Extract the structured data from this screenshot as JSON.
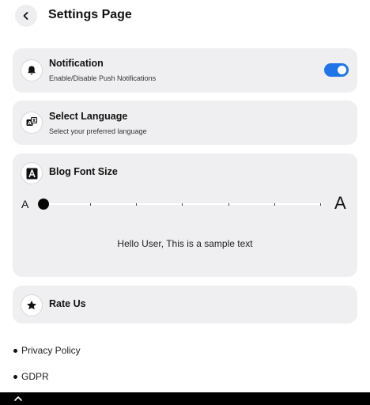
{
  "header": {
    "back_icon": "chevron-left-icon",
    "title": "Settings Page"
  },
  "notification": {
    "icon": "bell-icon",
    "title": "Notification",
    "subtitle": "Enable/Disable Push Notifications",
    "enabled": true,
    "toggle_color": "#1f75e8"
  },
  "language": {
    "icon": "translate-icon",
    "title": "Select Language",
    "subtitle": "Select your preferred language"
  },
  "font_size": {
    "icon": "font-icon",
    "title": "Blog Font Size",
    "small_label": "A",
    "large_label": "A",
    "slider_value": 0,
    "slider_steps": 6,
    "sample_text": "Hello User, This is a sample text"
  },
  "rate": {
    "icon": "star-icon",
    "title": "Rate Us"
  },
  "links": [
    {
      "label": "Privacy Policy"
    },
    {
      "label": "GDPR"
    }
  ],
  "nav_bar": {
    "icon": "chevron-up-icon"
  }
}
